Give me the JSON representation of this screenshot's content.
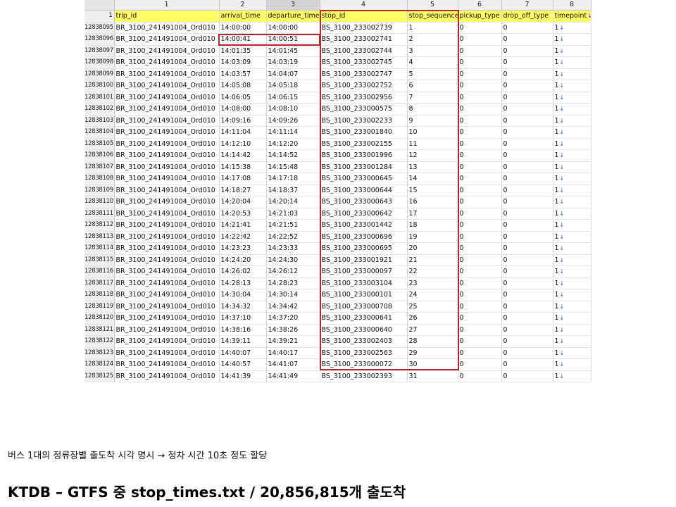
{
  "column_numbers": [
    "1",
    "2",
    "3",
    "4",
    "5",
    "6",
    "7",
    "8"
  ],
  "header": [
    "trip_id",
    "arrival_time",
    "departure_time",
    "stop_id",
    "stop_sequence",
    "pickup_type",
    "drop_off_type",
    "timepoint"
  ],
  "header_row_number": "1",
  "rows": [
    [
      "12838095",
      "BR_3100_241491004_Ord010",
      "14:00:00",
      "14:00:00",
      "BS_3100_233002739",
      "1",
      "0",
      "0",
      "1"
    ],
    [
      "12838096",
      "BR_3100_241491004_Ord010",
      "14:00:41",
      "14:00:51",
      "BS_3100_233002741",
      "2",
      "0",
      "0",
      "1"
    ],
    [
      "12838097",
      "BR_3100_241491004_Ord010",
      "14:01:35",
      "14:01:45",
      "BS_3100_233002744",
      "3",
      "0",
      "0",
      "1"
    ],
    [
      "12838098",
      "BR_3100_241491004_Ord010",
      "14:03:09",
      "14:03:19",
      "BS_3100_233002745",
      "4",
      "0",
      "0",
      "1"
    ],
    [
      "12838099",
      "BR_3100_241491004_Ord010",
      "14:03:57",
      "14:04:07",
      "BS_3100_233002747",
      "5",
      "0",
      "0",
      "1"
    ],
    [
      "12838100",
      "BR_3100_241491004_Ord010",
      "14:05:08",
      "14:05:18",
      "BS_3100_233002752",
      "6",
      "0",
      "0",
      "1"
    ],
    [
      "12838101",
      "BR_3100_241491004_Ord010",
      "14:06:05",
      "14:06:15",
      "BS_3100_233002956",
      "7",
      "0",
      "0",
      "1"
    ],
    [
      "12838102",
      "BR_3100_241491004_Ord010",
      "14:08:00",
      "14:08:10",
      "BS_3100_233000575",
      "8",
      "0",
      "0",
      "1"
    ],
    [
      "12838103",
      "BR_3100_241491004_Ord010",
      "14:09:16",
      "14:09:26",
      "BS_3100_233002233",
      "9",
      "0",
      "0",
      "1"
    ],
    [
      "12838104",
      "BR_3100_241491004_Ord010",
      "14:11:04",
      "14:11:14",
      "BS_3100_233001840",
      "10",
      "0",
      "0",
      "1"
    ],
    [
      "12838105",
      "BR_3100_241491004_Ord010",
      "14:12:10",
      "14:12:20",
      "BS_3100_233002155",
      "11",
      "0",
      "0",
      "1"
    ],
    [
      "12838106",
      "BR_3100_241491004_Ord010",
      "14:14:42",
      "14:14:52",
      "BS_3100_233001996",
      "12",
      "0",
      "0",
      "1"
    ],
    [
      "12838107",
      "BR_3100_241491004_Ord010",
      "14:15:38",
      "14:15:48",
      "BS_3100_233001284",
      "13",
      "0",
      "0",
      "1"
    ],
    [
      "12838108",
      "BR_3100_241491004_Ord010",
      "14:17:08",
      "14:17:18",
      "BS_3100_233000645",
      "14",
      "0",
      "0",
      "1"
    ],
    [
      "12838109",
      "BR_3100_241491004_Ord010",
      "14:18:27",
      "14:18:37",
      "BS_3100_233000644",
      "15",
      "0",
      "0",
      "1"
    ],
    [
      "12838110",
      "BR_3100_241491004_Ord010",
      "14:20:04",
      "14:20:14",
      "BS_3100_233000643",
      "16",
      "0",
      "0",
      "1"
    ],
    [
      "12838111",
      "BR_3100_241491004_Ord010",
      "14:20:53",
      "14:21:03",
      "BS_3100_233000642",
      "17",
      "0",
      "0",
      "1"
    ],
    [
      "12838112",
      "BR_3100_241491004_Ord010",
      "14:21:41",
      "14:21:51",
      "BS_3100_233001442",
      "18",
      "0",
      "0",
      "1"
    ],
    [
      "12838113",
      "BR_3100_241491004_Ord010",
      "14:22:42",
      "14:22:52",
      "BS_3100_233000696",
      "19",
      "0",
      "0",
      "1"
    ],
    [
      "12838114",
      "BR_3100_241491004_Ord010",
      "14:23:23",
      "14:23:33",
      "BS_3100_233000695",
      "20",
      "0",
      "0",
      "1"
    ],
    [
      "12838115",
      "BR_3100_241491004_Ord010",
      "14:24:20",
      "14:24:30",
      "BS_3100_233001921",
      "21",
      "0",
      "0",
      "1"
    ],
    [
      "12838116",
      "BR_3100_241491004_Ord010",
      "14:26:02",
      "14:26:12",
      "BS_3100_233000097",
      "22",
      "0",
      "0",
      "1"
    ],
    [
      "12838117",
      "BR_3100_241491004_Ord010",
      "14:28:13",
      "14:28:23",
      "BS_3100_233003104",
      "23",
      "0",
      "0",
      "1"
    ],
    [
      "12838118",
      "BR_3100_241491004_Ord010",
      "14:30:04",
      "14:30:14",
      "BS_3100_233000101",
      "24",
      "0",
      "0",
      "1"
    ],
    [
      "12838119",
      "BR_3100_241491004_Ord010",
      "14:34:32",
      "14:34:42",
      "BS_3100_233000708",
      "25",
      "0",
      "0",
      "1"
    ],
    [
      "12838120",
      "BR_3100_241491004_Ord010",
      "14:37:10",
      "14:37:20",
      "BS_3100_233000641",
      "26",
      "0",
      "0",
      "1"
    ],
    [
      "12838121",
      "BR_3100_241491004_Ord010",
      "14:38:16",
      "14:38:26",
      "BS_3100_233000640",
      "27",
      "0",
      "0",
      "1"
    ],
    [
      "12838122",
      "BR_3100_241491004_Ord010",
      "14:39:11",
      "14:39:21",
      "BS_3100_233002403",
      "28",
      "0",
      "0",
      "1"
    ],
    [
      "12838123",
      "BR_3100_241491004_Ord010",
      "14:40:07",
      "14:40:17",
      "BS_3100_233002563",
      "29",
      "0",
      "0",
      "1"
    ],
    [
      "12838124",
      "BR_3100_241491004_Ord010",
      "14:40:57",
      "14:41:07",
      "BS_3100_233000072",
      "30",
      "0",
      "0",
      "1"
    ],
    [
      "12838125",
      "BR_3100_241491004_Ord010",
      "14:41:39",
      "14:41:49",
      "BS_3100_233002393",
      "31",
      "0",
      "0",
      "1"
    ]
  ],
  "arrow_glyph": "↓",
  "note": "버스 1대의 정류장별 출도착 시각 명시 → 정차 시간 10초 정도 할당",
  "title": "KTDB – GTFS 중 stop_times.txt / 20,856,815개 출도착",
  "colors": {
    "header_bg": "#ffff66",
    "highlight_border": "#b3262b",
    "arrow": "#1f5fd1"
  }
}
